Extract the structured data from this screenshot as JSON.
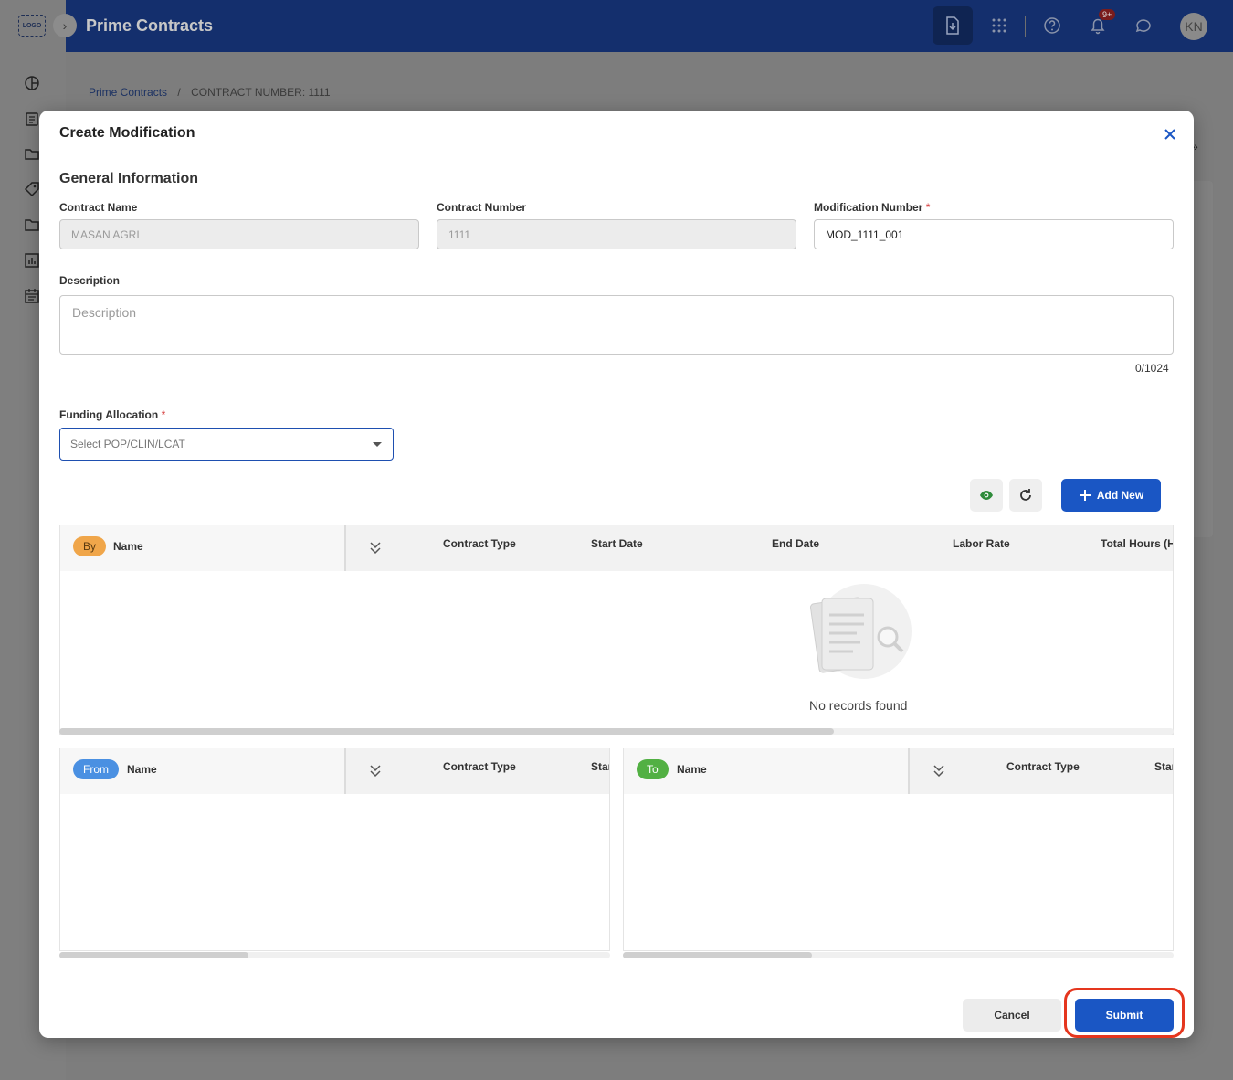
{
  "app": {
    "logo_text": "LOGO",
    "title": "Prime Contracts",
    "notification_badge": "9+",
    "avatar_initials": "KN"
  },
  "breadcrumb": {
    "root": "Prime Contracts",
    "separator": "/",
    "current": "CONTRACT NUMBER: 1111"
  },
  "modal": {
    "title": "Create Modification",
    "section_title": "General Information",
    "fields": {
      "contract_name": {
        "label": "Contract Name",
        "value": "MASAN AGRI"
      },
      "contract_number": {
        "label": "Contract Number",
        "value": "1111"
      },
      "modification_number": {
        "label": "Modification Number",
        "required_mark": "*",
        "value": "MOD_1111_001"
      },
      "description": {
        "label": "Description",
        "placeholder": "Description",
        "counter": "0/1024"
      },
      "funding_allocation": {
        "label": "Funding Allocation",
        "required_mark": "*",
        "placeholder": "Select POP/CLIN/LCAT"
      }
    },
    "add_new_label": "Add New",
    "by_table": {
      "chip": "By",
      "name_col": "Name",
      "columns": [
        "Contract Type",
        "Start Date",
        "End Date",
        "Labor Rate",
        "Total Hours (H"
      ],
      "empty_text": "No records found"
    },
    "from_table": {
      "chip": "From",
      "name_col": "Name",
      "columns": [
        "Contract Type",
        "Star"
      ]
    },
    "to_table": {
      "chip": "To",
      "name_col": "Name",
      "columns": [
        "Contract Type",
        "Star"
      ]
    },
    "cancel_label": "Cancel",
    "submit_label": "Submit"
  },
  "colors": {
    "primary": "#1a56c4",
    "topbar": "#142f6d",
    "required": "#d32f2f",
    "highlight": "#e5361e",
    "chip_by": "#f0a64a",
    "chip_from": "#4a90e2",
    "chip_to": "#52b043"
  }
}
